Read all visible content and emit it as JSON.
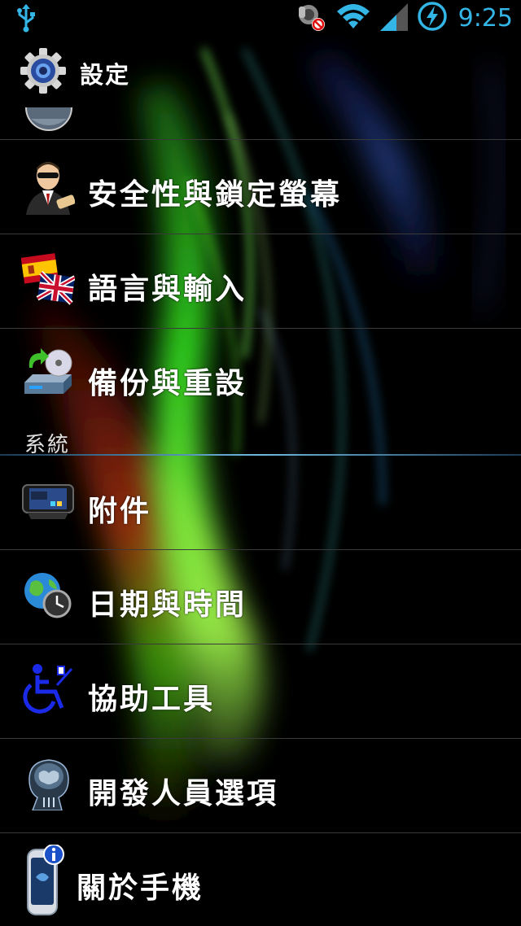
{
  "status_bar": {
    "time": "9:25",
    "icons": [
      "usb-icon",
      "do-not-disturb-icon",
      "wifi-icon",
      "signal-icon",
      "battery-charging-icon"
    ],
    "accent_color": "#33b5e5"
  },
  "action_bar": {
    "title": "設定",
    "icon": "gear-icon"
  },
  "list": {
    "partial_item_icon": "globe-icon",
    "items_top": [
      {
        "label": "安全性與鎖定螢幕",
        "icon": "security-agent-icon"
      },
      {
        "label": "語言與輸入",
        "icon": "language-flags-icon"
      },
      {
        "label": "備份與重設",
        "icon": "backup-disc-icon"
      }
    ],
    "section_header": "系統",
    "items_bottom": [
      {
        "label": "附件",
        "icon": "phone-dock-icon"
      },
      {
        "label": "日期與時間",
        "icon": "globe-clock-icon"
      },
      {
        "label": "協助工具",
        "icon": "accessibility-wheelchair-icon"
      },
      {
        "label": "開發人員選項",
        "icon": "xray-head-icon"
      },
      {
        "label": "關於手機",
        "icon": "phone-info-icon"
      }
    ]
  }
}
